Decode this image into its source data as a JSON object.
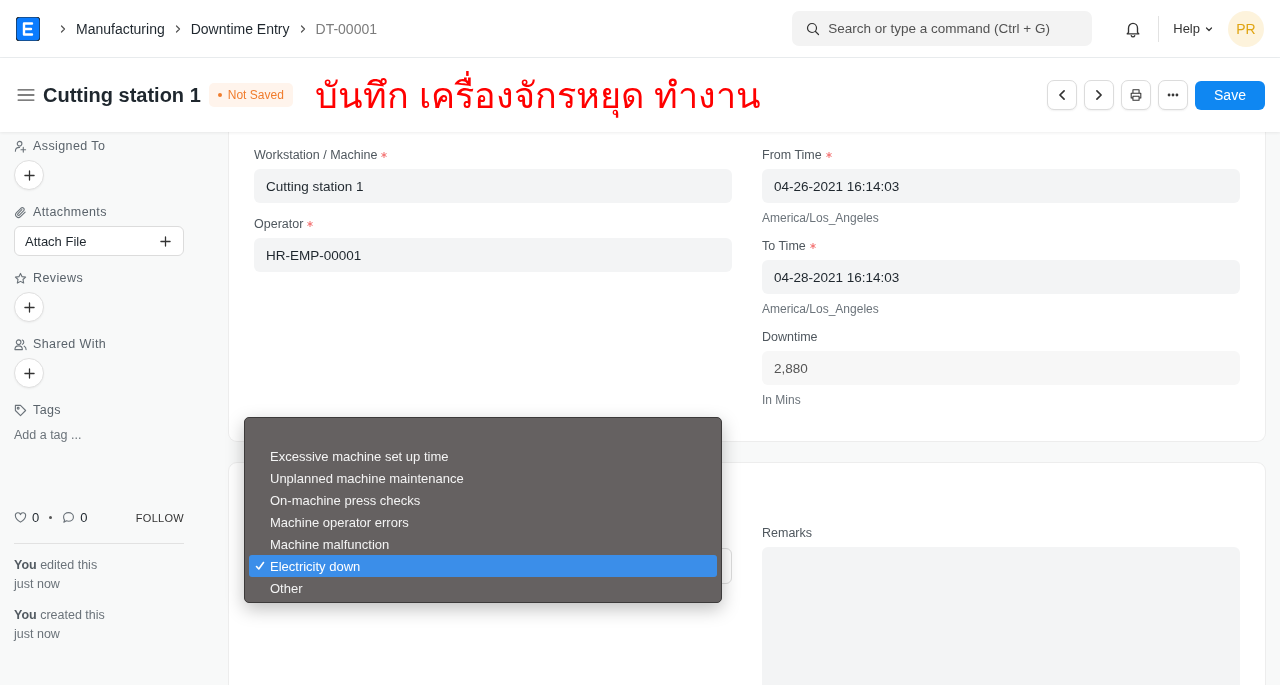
{
  "navbar": {
    "breadcrumbs": [
      {
        "label": "Manufacturing",
        "current": false
      },
      {
        "label": "Downtime Entry",
        "current": false
      },
      {
        "label": "DT-00001",
        "current": true
      }
    ],
    "search": {
      "placeholder": "Search or type a command (Ctrl + G)"
    },
    "help": "Help",
    "avatar": "PR"
  },
  "page_header": {
    "title": "Cutting station 1",
    "status": "Not Saved",
    "annotation": "บันทึก เครื่องจักรหยุด ทำงาน",
    "save": "Save"
  },
  "sidebar": {
    "sections": [
      {
        "kind": "add",
        "label": "Assigned To"
      },
      {
        "kind": "attach",
        "label": "Attachments",
        "button": "Attach File"
      },
      {
        "kind": "add",
        "label": "Reviews"
      },
      {
        "kind": "add",
        "label": "Shared With"
      },
      {
        "kind": "tags",
        "label": "Tags",
        "placeholder": "Add a tag ..."
      }
    ],
    "likes": "0",
    "comments": "0",
    "follow": "FOLLOW",
    "activity": [
      {
        "who": "You",
        "action": "edited this",
        "when": "just now"
      },
      {
        "who": "You",
        "action": "created this",
        "when": "just now"
      }
    ]
  },
  "form": {
    "left": [
      {
        "label": "Workstation / Machine",
        "required": true,
        "value": "Cutting station 1",
        "read_only": false
      },
      {
        "label": "Operator",
        "required": true,
        "value": "HR-EMP-00001",
        "read_only": false
      }
    ],
    "right": [
      {
        "label": "From Time",
        "required": true,
        "value": "04-26-2021 16:14:03",
        "read_only": false,
        "description": "America/Los_Angeles"
      },
      {
        "label": "To Time",
        "required": true,
        "value": "04-28-2021 16:14:03",
        "read_only": false,
        "description": "America/Los_Angeles"
      },
      {
        "label": "Downtime",
        "required": false,
        "value": "2,880",
        "read_only": true,
        "description": "In Mins"
      }
    ]
  },
  "section2": {
    "remarks_label": "Remarks"
  },
  "dropdown": {
    "options": [
      {
        "label": "Excessive machine set up time",
        "selected": false
      },
      {
        "label": "Unplanned machine maintenance",
        "selected": false
      },
      {
        "label": "On-machine press checks",
        "selected": false
      },
      {
        "label": "Machine operator errors",
        "selected": false
      },
      {
        "label": "Machine malfunction",
        "selected": false
      },
      {
        "label": "Electricity down",
        "selected": true
      },
      {
        "label": "Other",
        "selected": false
      }
    ]
  }
}
